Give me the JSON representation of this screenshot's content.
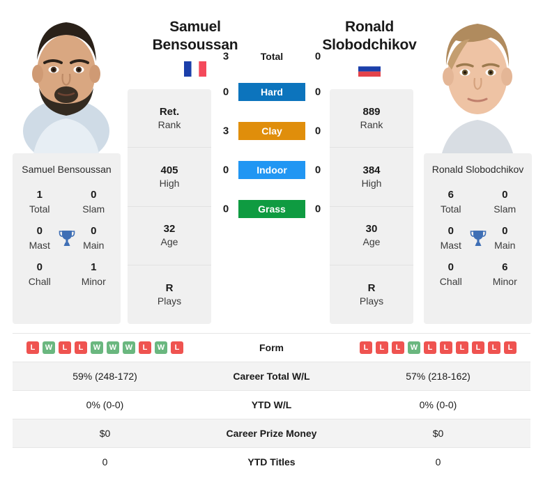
{
  "players": {
    "left": {
      "first_name": "Samuel",
      "last_name": "Bensoussan",
      "full_name": "Samuel Bensoussan",
      "country_flag": "france-flag-icon",
      "photo": "player-photo-left",
      "stats": [
        {
          "value": "Ret.",
          "label": "Rank"
        },
        {
          "value": "405",
          "label": "High"
        },
        {
          "value": "32",
          "label": "Age"
        },
        {
          "value": "R",
          "label": "Plays"
        }
      ],
      "titles": [
        {
          "value": "1",
          "label": "Total"
        },
        {
          "value": "0",
          "label": "Slam"
        },
        {
          "value": "0",
          "label": "Mast"
        },
        {
          "value": "0",
          "label": "Main"
        },
        {
          "value": "0",
          "label": "Chall"
        },
        {
          "value": "1",
          "label": "Minor"
        }
      ],
      "form": [
        "L",
        "W",
        "L",
        "L",
        "W",
        "W",
        "W",
        "L",
        "W",
        "L"
      ],
      "career_total_wl": "59% (248-172)",
      "ytd_wl": "0% (0-0)",
      "career_prize_money": "$0",
      "ytd_titles": "0"
    },
    "right": {
      "first_name": "Ronald",
      "last_name": "Slobodchikov",
      "full_name": "Ronald Slobodchikov",
      "country_flag": "russia-flag-icon",
      "photo": "player-photo-right",
      "stats": [
        {
          "value": "889",
          "label": "Rank"
        },
        {
          "value": "384",
          "label": "High"
        },
        {
          "value": "30",
          "label": "Age"
        },
        {
          "value": "R",
          "label": "Plays"
        }
      ],
      "titles": [
        {
          "value": "6",
          "label": "Total"
        },
        {
          "value": "0",
          "label": "Slam"
        },
        {
          "value": "0",
          "label": "Mast"
        },
        {
          "value": "0",
          "label": "Main"
        },
        {
          "value": "0",
          "label": "Chall"
        },
        {
          "value": "6",
          "label": "Minor"
        }
      ],
      "form": [
        "L",
        "L",
        "L",
        "W",
        "L",
        "L",
        "L",
        "L",
        "L",
        "L"
      ],
      "career_total_wl": "57% (218-162)",
      "ytd_wl": "0% (0-0)",
      "career_prize_money": "$0",
      "ytd_titles": "0"
    }
  },
  "head_to_head": {
    "total": {
      "label": "Total",
      "left": "3",
      "right": "0"
    },
    "surfaces": [
      {
        "label": "Hard",
        "left": "0",
        "right": "0",
        "color": "#0c74bd"
      },
      {
        "label": "Clay",
        "left": "3",
        "right": "0",
        "color": "#e08e0b"
      },
      {
        "label": "Indoor",
        "left": "0",
        "right": "0",
        "color": "#2196f3"
      },
      {
        "label": "Grass",
        "left": "0",
        "right": "0",
        "color": "#0f9b41"
      }
    ]
  },
  "comparison_rows": [
    {
      "label": "Form",
      "key": "form",
      "type": "form"
    },
    {
      "label": "Career Total W/L",
      "key": "career_total_wl",
      "type": "text"
    },
    {
      "label": "YTD W/L",
      "key": "ytd_wl",
      "type": "text"
    },
    {
      "label": "Career Prize Money",
      "key": "career_prize_money",
      "type": "text"
    },
    {
      "label": "YTD Titles",
      "key": "ytd_titles",
      "type": "text"
    }
  ],
  "colors": {
    "win_badge": "#6ab77f",
    "loss_badge": "#ef5350",
    "card_bg": "#f0f0f0",
    "row_shade": "#f3f3f3",
    "trophy": "#3f6fb5"
  }
}
